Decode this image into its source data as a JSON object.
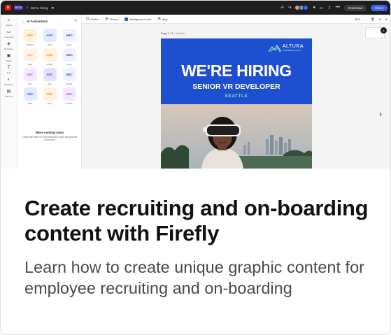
{
  "app": {
    "badge": "BETA",
    "doc_title": "We're Hiring",
    "download_label": "Download",
    "share_label": "Share"
  },
  "left_rail": [
    {
      "icon": "search-icon",
      "label": "Search"
    },
    {
      "icon": "your-stuff-icon",
      "label": "Your stuff"
    },
    {
      "icon": "templates-icon",
      "label": "Templates"
    },
    {
      "icon": "media-icon",
      "label": "Media"
    },
    {
      "icon": "text-icon",
      "label": "Text"
    },
    {
      "icon": "elements-icon",
      "label": "Elements"
    },
    {
      "icon": "add-ons-icon",
      "label": "Add-ons"
    }
  ],
  "panel": {
    "title": "In Animations",
    "tiles": [
      {
        "label": "Bungee",
        "bg": "#fff1dc",
        "fg": "#f29a1c"
      },
      {
        "label": "Drift",
        "bg": "#e3ecff",
        "fg": "#3b63fb"
      },
      {
        "label": "Drop",
        "bg": "#eef1ff",
        "fg": "#3b4bd0"
      },
      {
        "label": "Fade",
        "bg": "#fff3e6",
        "fg": "#f5b06a"
      },
      {
        "label": "Flicker",
        "bg": "#fff1dc",
        "fg": "#f29a1c"
      },
      {
        "label": "Grow",
        "bg": "#eef1ff",
        "fg": "#3b4bd0"
      },
      {
        "label": "Pop",
        "bg": "#f3e8ff",
        "fg": "#b35ce8"
      },
      {
        "label": "Rise",
        "bg": "#e6e1ff",
        "fg": "#6b4ce8"
      },
      {
        "label": "Shrink",
        "bg": "#eef1ff",
        "fg": "#3b4bd0"
      },
      {
        "label": "Slide",
        "bg": "#e3ecff",
        "fg": "#3b63fb"
      },
      {
        "label": "Spin",
        "bg": "#fff1dc",
        "fg": "#f29a1c"
      },
      {
        "label": "Tumble",
        "bg": "#f3e8ff",
        "fg": "#b35ce8"
      }
    ],
    "tile_text": "ABC",
    "coming_title": "More coming soon",
    "coming_sub": "Check back later for more animation styles being added all the time"
  },
  "toolbar": {
    "resize": "Resize",
    "theme": "Theme",
    "background_color": "Background color",
    "align": "Align",
    "zoom": "39%"
  },
  "canvas": {
    "page_label": "Page 1 / 3",
    "add_title": "- Add title",
    "page_count": "4"
  },
  "poster": {
    "brand_name": "ALTURA",
    "brand_sub": "TECHNOLOGY",
    "headline": "WE'RE HIRING",
    "role": "SENIOR VR DEVELOPER",
    "city": "SEATTLE"
  },
  "article": {
    "headline": "Create recruiting and on-boarding content with Firefly",
    "subline": "Learn how to create unique graphic content for employee recruiting and on-boarding"
  }
}
